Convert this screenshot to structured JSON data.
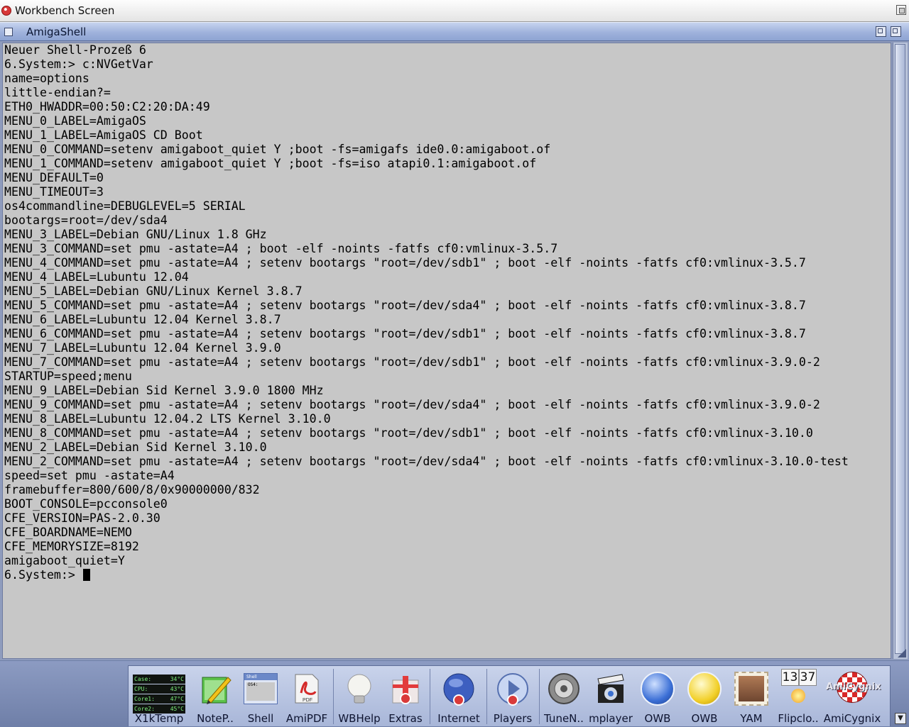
{
  "screen": {
    "title": "Workbench Screen"
  },
  "window": {
    "title": "AmigaShell"
  },
  "console": {
    "lines": [
      "Neuer Shell-Prozeß 6",
      "6.System:> c:NVGetVar",
      "name=options",
      "little-endian?=",
      "ETH0_HWADDR=00:50:C2:20:DA:49",
      "MENU_0_LABEL=AmigaOS",
      "MENU_1_LABEL=AmigaOS CD Boot",
      "MENU_0_COMMAND=setenv amigaboot_quiet Y ;boot -fs=amigafs ide0.0:amigaboot.of",
      "MENU_1_COMMAND=setenv amigaboot_quiet Y ;boot -fs=iso atapi0.1:amigaboot.of",
      "MENU_DEFAULT=0",
      "MENU_TIMEOUT=3",
      "os4commandline=DEBUGLEVEL=5 SERIAL",
      "bootargs=root=/dev/sda4",
      "MENU_3_LABEL=Debian GNU/Linux 1.8 GHz",
      "MENU_3_COMMAND=set pmu -astate=A4 ; boot -elf -noints -fatfs cf0:vmlinux-3.5.7",
      "MENU_4_COMMAND=set pmu -astate=A4 ; setenv bootargs \"root=/dev/sdb1\" ; boot -elf -noints -fatfs cf0:vmlinux-3.5.7",
      "MENU_4_LABEL=Lubuntu 12.04",
      "MENU_5_LABEL=Debian GNU/Linux Kernel 3.8.7",
      "MENU_5_COMMAND=set pmu -astate=A4 ; setenv bootargs \"root=/dev/sda4\" ; boot -elf -noints -fatfs cf0:vmlinux-3.8.7",
      "MENU_6_LABEL=Lubuntu 12.04 Kernel 3.8.7",
      "MENU_6_COMMAND=set pmu -astate=A4 ; setenv bootargs \"root=/dev/sdb1\" ; boot -elf -noints -fatfs cf0:vmlinux-3.8.7",
      "MENU_7_LABEL=Lubuntu 12.04 Kernel 3.9.0",
      "MENU_7_COMMAND=set pmu -astate=A4 ; setenv bootargs \"root=/dev/sdb1\" ; boot -elf -noints -fatfs cf0:vmlinux-3.9.0-2",
      "STARTUP=speed;menu",
      "MENU_9_LABEL=Debian Sid Kernel 3.9.0 1800 MHz",
      "MENU_9_COMMAND=set pmu -astate=A4 ; setenv bootargs \"root=/dev/sda4\" ; boot -elf -noints -fatfs cf0:vmlinux-3.9.0-2",
      "MENU_8_LABEL=Lubuntu 12.04.2 LTS Kernel 3.10.0",
      "MENU_8_COMMAND=set pmu -astate=A4 ; setenv bootargs \"root=/dev/sdb1\" ; boot -elf -noints -fatfs cf0:vmlinux-3.10.0",
      "MENU_2_LABEL=Debian Sid Kernel 3.10.0",
      "MENU_2_COMMAND=set pmu -astate=A4 ; setenv bootargs \"root=/dev/sda4\" ; boot -elf -noints -fatfs cf0:vmlinux-3.10.0-test",
      "speed=set pmu -astate=A4",
      "framebuffer=800/600/8/0x90000000/832",
      "BOOT_CONSOLE=pcconsole0",
      "CFE_VERSION=PAS-2.0.30",
      "CFE_BOARDNAME=NEMO",
      "CFE_MEMORYSIZE=8192",
      "amigaboot_quiet=Y"
    ],
    "prompt": "6.System:> "
  },
  "dock": {
    "temps": [
      {
        "label": "Case:",
        "value": "34°C"
      },
      {
        "label": "CPU:",
        "value": "43°C"
      },
      {
        "label": "Core1:",
        "value": "47°C"
      },
      {
        "label": "Core2:",
        "value": "45°C"
      }
    ],
    "shell_thumb": {
      "title": "Shell",
      "body": "OS4:"
    },
    "pdf_text": "PDF",
    "clock": {
      "hours": "13",
      "minutes": "37"
    },
    "amicygnix_text": "AmiCygnix",
    "items": [
      {
        "label": "X1kTemp",
        "icon": "temperature-monitor-icon"
      },
      {
        "label": "NoteP..",
        "icon": "notepad-pencil-icon"
      },
      {
        "label": "Shell",
        "icon": "shell-window-icon"
      },
      {
        "label": "AmiPDF",
        "icon": "pdf-document-icon"
      },
      {
        "label": "WBHelp",
        "icon": "lightbulb-icon"
      },
      {
        "label": "Extras",
        "icon": "gift-box-icon"
      },
      {
        "label": "Internet",
        "icon": "globe-icon"
      },
      {
        "label": "Players",
        "icon": "play-button-icon"
      },
      {
        "label": "TuneN..",
        "icon": "speaker-icon"
      },
      {
        "label": "mplayer",
        "icon": "movie-clapper-icon"
      },
      {
        "label": "OWB",
        "icon": "blue-orb-icon"
      },
      {
        "label": "OWB",
        "icon": "yellow-orb-icon"
      },
      {
        "label": "YAM",
        "icon": "mail-stamp-icon"
      },
      {
        "label": "Flipclo..",
        "icon": "flip-clock-icon"
      },
      {
        "label": "AmiCygnix",
        "icon": "boing-ball-icon"
      }
    ]
  }
}
